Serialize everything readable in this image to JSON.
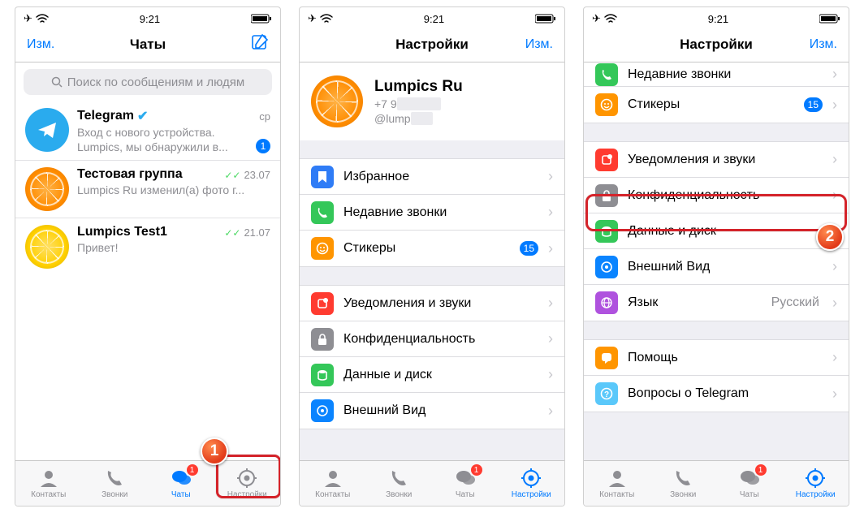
{
  "status": {
    "time": "9:21"
  },
  "screen1": {
    "nav": {
      "left": "Изм.",
      "title": "Чаты"
    },
    "search_placeholder": "Поиск по сообщениям и людям",
    "chats": [
      {
        "name": "Telegram",
        "date": "ср",
        "preview1": "Вход с нового устройства.",
        "preview2": "Lumpics, мы обнаружили в...",
        "unread": "1"
      },
      {
        "name": "Тестовая группа",
        "date": "23.07",
        "preview1": "Lumpics Ru изменил(а) фото г..."
      },
      {
        "name": "Lumpics Test1",
        "date": "21.07",
        "preview1": "Привет!"
      }
    ],
    "tabs": {
      "contacts": "Контакты",
      "calls": "Звонки",
      "chats": "Чаты",
      "settings": "Настройки",
      "badge": "1"
    },
    "step": "1"
  },
  "screen2": {
    "nav": {
      "title": "Настройки",
      "right": "Изм."
    },
    "profile": {
      "name": "Lumpics Ru",
      "phone": "+7 9",
      "username": "@lump"
    },
    "rows1": [
      {
        "label": "Избранное",
        "color": "#2f7cf6"
      },
      {
        "label": "Недавние звонки",
        "color": "#34c759"
      },
      {
        "label": "Стикеры",
        "color": "#ff9500",
        "badge": "15"
      }
    ],
    "rows2": [
      {
        "label": "Уведомления и звуки",
        "color": "#ff3b30"
      },
      {
        "label": "Конфиденциальность",
        "color": "#8e8e93"
      },
      {
        "label": "Данные и диск",
        "color": "#34c759"
      },
      {
        "label": "Внешний Вид",
        "color": "#0a84ff"
      }
    ],
    "tabs": {
      "contacts": "Контакты",
      "calls": "Звонки",
      "chats": "Чаты",
      "settings": "Настройки",
      "badge": "1"
    }
  },
  "screen3": {
    "nav": {
      "title": "Настройки",
      "right": "Изм."
    },
    "rows0": [
      {
        "label": "Недавние звонки",
        "color": "#34c759"
      },
      {
        "label": "Стикеры",
        "color": "#ff9500",
        "badge": "15"
      }
    ],
    "rows1": [
      {
        "label": "Уведомления и звуки",
        "color": "#ff3b30"
      },
      {
        "label": "Конфиденциальность",
        "color": "#8e8e93"
      },
      {
        "label": "Данные и диск",
        "color": "#34c759"
      },
      {
        "label": "Внешний Вид",
        "color": "#0a84ff"
      },
      {
        "label": "Язык",
        "color": "#af52de",
        "value": "Русский"
      }
    ],
    "rows2": [
      {
        "label": "Помощь",
        "color": "#ff9500"
      },
      {
        "label": "Вопросы о Telegram",
        "color": "#5ac8fa"
      }
    ],
    "tabs": {
      "contacts": "Контакты",
      "calls": "Звонки",
      "chats": "Чаты",
      "settings": "Настройки",
      "badge": "1"
    },
    "step": "2"
  }
}
